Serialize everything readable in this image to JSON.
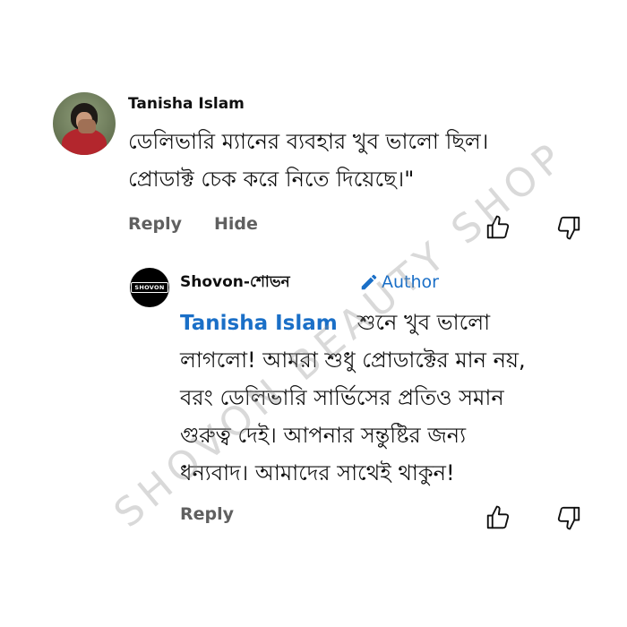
{
  "comment": {
    "author": "Tanisha Islam",
    "text_lines": [
      "ডেলিভারি ম্যানের ব্যবহার খুব ভালো ছিল।",
      "প্রোডাক্ট চেক করে নিতে দিয়েছে।\""
    ],
    "reply_label": "Reply",
    "hide_label": "Hide",
    "like_icon": "thumbs-up-icon",
    "dislike_icon": "thumbs-down-icon"
  },
  "reply": {
    "author": "Shovon-শোভন",
    "avatar_text": "SHOVON",
    "badge_label": "Author",
    "badge_icon": "pencil-icon",
    "mention": "Tanisha Islam",
    "first_line_text": "শুনে খুব ভালো",
    "text_lines": [
      "লাগলো! আমরা শুধু প্রোডাক্টের মান নয়,",
      "বরং ডেলিভারি সার্ভিসের প্রতিও সমান",
      "গুরুত্ব দেই। আপনার সন্তুষ্টির জন্য",
      "ধন্যবাদ। আমাদের সাথেই থাকুন!"
    ],
    "reply_label": "Reply",
    "like_icon": "thumbs-up-icon",
    "dislike_icon": "thumbs-down-icon"
  },
  "watermark": "SHOVON BEAUTY SHOP",
  "colors": {
    "background": "#ffffff",
    "text": "#0f0f0f",
    "action": "#606060",
    "accent_blue": "#1a6fc7"
  }
}
